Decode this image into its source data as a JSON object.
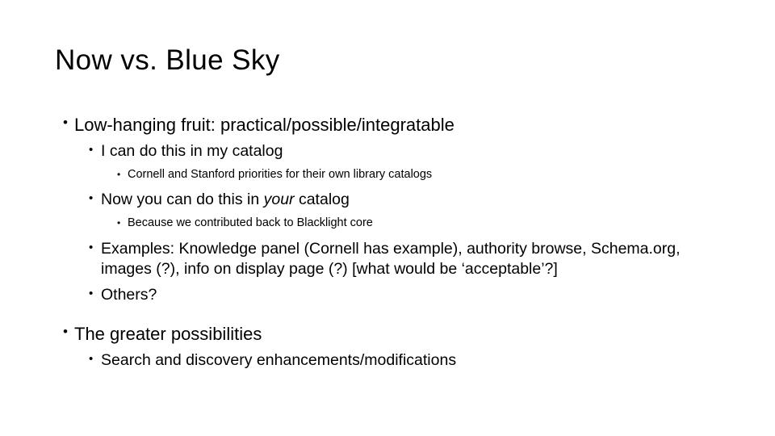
{
  "slide": {
    "title": "Now vs. Blue Sky",
    "background_color": "#ffffff",
    "text_color": "#000000",
    "bullet_marker": "•",
    "content": [
      {
        "level": 1,
        "name": "bullet-low-hanging-fruit",
        "text": "Low-hanging fruit: practical/possible/integratable"
      },
      {
        "level": 2,
        "name": "bullet-i-can-do-this",
        "text": "I can do this in my catalog"
      },
      {
        "level": 3,
        "name": "bullet-cornell-stanford-priorities",
        "text": "Cornell and Stanford priorities for their own library catalogs"
      },
      {
        "level": 2,
        "name": "bullet-now-you-can-do-this",
        "text_before_italic": "Now you can do this in ",
        "italic_text": "your",
        "text_after_italic": " catalog"
      },
      {
        "level": 3,
        "name": "bullet-blacklight-core",
        "text": "Because we contributed back to Blacklight core"
      },
      {
        "level": 2,
        "name": "bullet-examples",
        "text": "Examples: Knowledge panel (Cornell has example), authority browse, Schema.org, images (?), info on display page (?) [what would be ‘acceptable’?]"
      },
      {
        "level": 2,
        "name": "bullet-others",
        "text": "Others?"
      },
      {
        "level": 1,
        "name": "bullet-greater-possibilities",
        "text": "The greater possibilities"
      },
      {
        "level": 2,
        "name": "bullet-search-discovery",
        "text": "Search and discovery enhancements/modifications"
      }
    ]
  }
}
